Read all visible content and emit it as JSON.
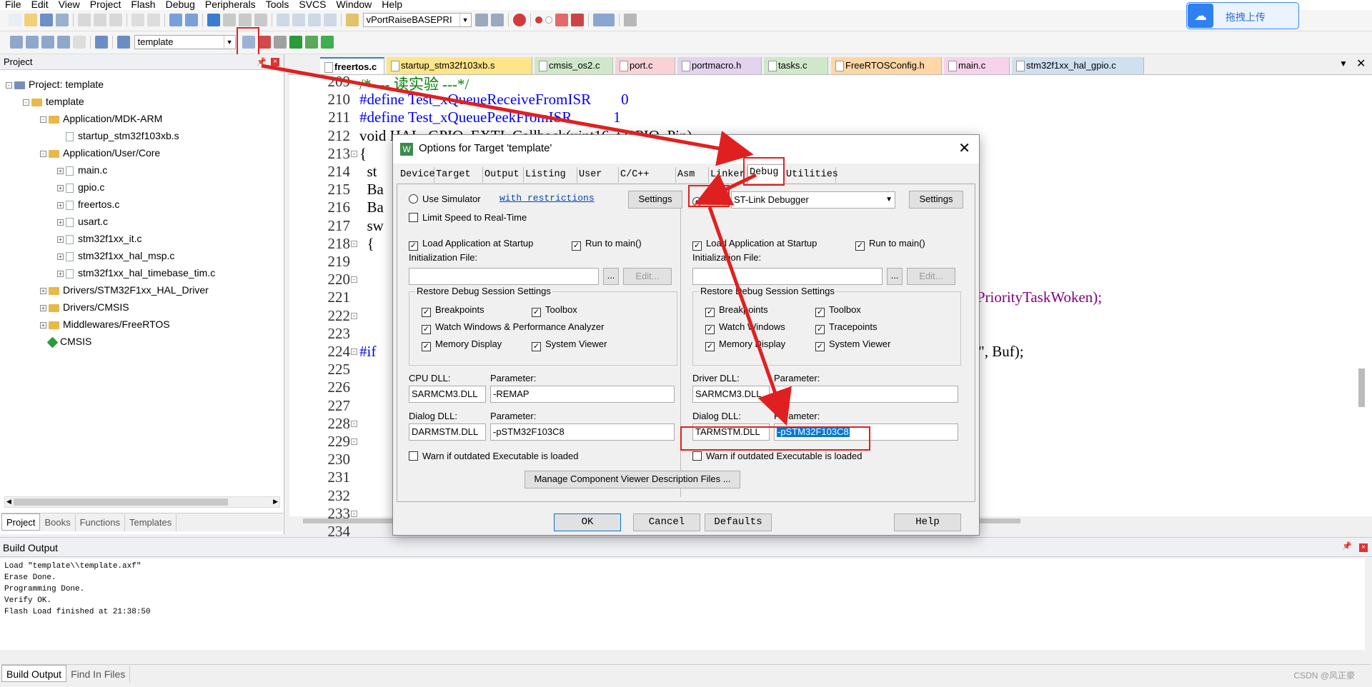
{
  "menu": [
    "File",
    "Edit",
    "View",
    "Project",
    "Flash",
    "Debug",
    "Peripherals",
    "Tools",
    "SVCS",
    "Window",
    "Help"
  ],
  "toolbar": {
    "function_combo": "vPortRaiseBASEPRI",
    "target_combo": "template",
    "upload_label": "拖拽上传"
  },
  "project_panel": {
    "title": "Project",
    "tree": [
      {
        "label": "Project: template",
        "level": 0,
        "type": "root",
        "expand": "-"
      },
      {
        "label": "template",
        "level": 1,
        "type": "target",
        "expand": "-"
      },
      {
        "label": "Application/MDK-ARM",
        "level": 2,
        "type": "folder",
        "expand": "-"
      },
      {
        "label": "startup_stm32f103xb.s",
        "level": 3,
        "type": "file",
        "expand": ""
      },
      {
        "label": "Application/User/Core",
        "level": 2,
        "type": "folder",
        "expand": "-"
      },
      {
        "label": "main.c",
        "level": 3,
        "type": "file",
        "expand": "+"
      },
      {
        "label": "gpio.c",
        "level": 3,
        "type": "file",
        "expand": "+"
      },
      {
        "label": "freertos.c",
        "level": 3,
        "type": "file",
        "expand": "+"
      },
      {
        "label": "usart.c",
        "level": 3,
        "type": "file",
        "expand": "+"
      },
      {
        "label": "stm32f1xx_it.c",
        "level": 3,
        "type": "file",
        "expand": "+"
      },
      {
        "label": "stm32f1xx_hal_msp.c",
        "level": 3,
        "type": "file",
        "expand": "+"
      },
      {
        "label": "stm32f1xx_hal_timebase_tim.c",
        "level": 3,
        "type": "file",
        "expand": "+"
      },
      {
        "label": "Drivers/STM32F1xx_HAL_Driver",
        "level": 2,
        "type": "folder",
        "expand": "+"
      },
      {
        "label": "Drivers/CMSIS",
        "level": 2,
        "type": "folder",
        "expand": "+"
      },
      {
        "label": "Middlewares/FreeRTOS",
        "level": 2,
        "type": "folder",
        "expand": "+"
      },
      {
        "label": "CMSIS",
        "level": 2,
        "type": "component",
        "expand": ""
      }
    ],
    "bottom_tabs": [
      "Project",
      "Books",
      "Functions",
      "Templates"
    ]
  },
  "editor_tabs": [
    {
      "label": "freertos.c",
      "color": "#ffffff"
    },
    {
      "label": "startup_stm32f103xb.s",
      "color": "#ffe58a"
    },
    {
      "label": "cmsis_os2.c",
      "color": "#cfe8c9"
    },
    {
      "label": "port.c",
      "color": "#f8d2d6"
    },
    {
      "label": "portmacro.h",
      "color": "#e2d4ef"
    },
    {
      "label": "tasks.c",
      "color": "#cfe8c9"
    },
    {
      "label": "FreeRTOSConfig.h",
      "color": "#ffd6a6"
    },
    {
      "label": "main.c",
      "color": "#f6d3ea"
    },
    {
      "label": "stm32f1xx_hal_gpio.c",
      "color": "#cfe0f0"
    }
  ],
  "code_lines": [
    {
      "n": "209",
      "t": "/* --- 读实验 ---*/"
    },
    {
      "n": "210",
      "t": "#define Test_xQueueReceiveFromISR        0"
    },
    {
      "n": "211",
      "t": "#define Test_xQueuePeekFromISR           1"
    },
    {
      "n": "212",
      "t": "void HAL_GPIO_EXTI_Callback(uint16_t GPIO_Pin)"
    },
    {
      "n": "213",
      "t": "{"
    },
    {
      "n": "214",
      "t": "  st"
    },
    {
      "n": "215",
      "t": "  Ba"
    },
    {
      "n": "216",
      "t": "  Ba"
    },
    {
      "n": "217",
      "t": "  sw"
    },
    {
      "n": "218",
      "t": "  {"
    },
    {
      "n": "219",
      "t": ""
    },
    {
      "n": "220",
      "t": ""
    },
    {
      "n": "221",
      "t": ""
    },
    {
      "n": "222",
      "t": ""
    },
    {
      "n": "223",
      "t": ""
    },
    {
      "n": "224",
      "t": "#if"
    },
    {
      "n": "225",
      "t": ""
    },
    {
      "n": "226",
      "t": ""
    },
    {
      "n": "227",
      "t": ""
    },
    {
      "n": "228",
      "t": ""
    },
    {
      "n": "229",
      "t": ""
    },
    {
      "n": "230",
      "t": ""
    },
    {
      "n": "231",
      "t": ""
    },
    {
      "n": "232",
      "t": ""
    },
    {
      "n": "233",
      "t": ""
    },
    {
      "n": "234",
      "t": ""
    },
    {
      "n": "235",
      "t": ""
    }
  ],
  "code_fragments": {
    "line226": "herPriorityTaskWoken);",
    "line230": "\\r\\n\", Buf);"
  },
  "dialog": {
    "title": "Options for Target 'template'",
    "tabs": [
      "Device",
      "Target",
      "Output",
      "Listing",
      "User",
      "C/C++",
      "Asm",
      "Linker",
      "Debug",
      "Utilities"
    ],
    "active_tab": "Debug",
    "left": {
      "use_simulator": "Use Simulator",
      "restrictions_link": "with restrictions",
      "settings": "Settings",
      "limit_speed": "Limit Speed to Real-Time",
      "load_app": "Load Application at Startup",
      "run_main": "Run to main()",
      "init_file_label": "Initialization File:",
      "browse": "...",
      "edit": "Edit...",
      "restore_title": "Restore Debug Session Settings",
      "breakpoints": "Breakpoints",
      "toolbox": "Toolbox",
      "watch": "Watch Windows & Performance Analyzer",
      "memory": "Memory Display",
      "sysview": "System Viewer",
      "dll_label": "CPU DLL:",
      "param_label": "Parameter:",
      "dll": "SARMCM3.DLL",
      "param": "-REMAP",
      "dialog_dll_label": "Dialog DLL:",
      "dialog_dll": "DARMSTM.DLL",
      "dialog_param": "-pSTM32F103C8",
      "warn": "Warn if outdated Executable is loaded"
    },
    "right": {
      "use": "Use:",
      "debugger": "ST-Link Debugger",
      "settings": "Settings",
      "load_app": "Load Application at Startup",
      "run_main": "Run to main()",
      "init_file_label": "Initialization File:",
      "browse": "...",
      "edit": "Edit...",
      "restore_title": "Restore Debug Session Settings",
      "breakpoints": "Breakpoints",
      "toolbox": "Toolbox",
      "watch": "Watch Windows",
      "tracepoints": "Tracepoints",
      "memory": "Memory Display",
      "sysview": "System Viewer",
      "dll_label": "Driver DLL:",
      "param_label": "Parameter:",
      "dll": "SARMCM3.DLL",
      "param": "",
      "dialog_dll_label": "Dialog DLL:",
      "dialog_dll": "TARMSTM.DLL",
      "dialog_param": "-pSTM32F103C8",
      "warn": "Warn if outdated Executable is loaded"
    },
    "manage_btn": "Manage Component Viewer Description Files ...",
    "buttons": {
      "ok": "OK",
      "cancel": "Cancel",
      "defaults": "Defaults",
      "help": "Help"
    }
  },
  "build_output": {
    "title": "Build Output",
    "lines": "Load \"template\\\\template.axf\"\nErase Done.\nProgramming Done.\nVerify OK.\nFlash Load finished at 21:38:50",
    "tabs": [
      "Build Output",
      "Find In Files"
    ]
  },
  "watermark": "CSDN @风正豪",
  "colors": {
    "accent_red": "#e02020",
    "selection": "#0078d7"
  }
}
